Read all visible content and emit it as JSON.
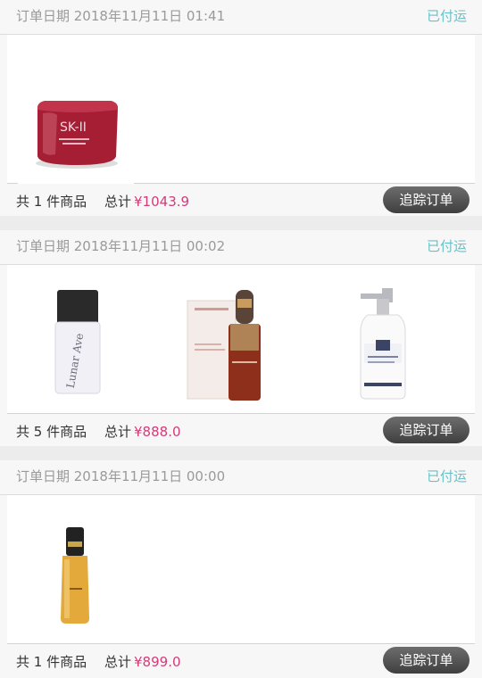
{
  "orders": [
    {
      "date_label": "订单日期 2018年11月11日 01:41",
      "status": "已付运",
      "products": [
        {
          "icon": "sk2-cream-jar-icon"
        }
      ],
      "item_count": "共 1 件商品",
      "total_label": "总计",
      "total_amount": "¥1043.9",
      "track_button": "追踪订单"
    },
    {
      "date_label": "订单日期 2018年11月11日 00:02",
      "status": "已付运",
      "products": [
        {
          "icon": "primer-bottle-icon"
        },
        {
          "icon": "serum-dropper-box-icon"
        },
        {
          "icon": "pump-lotion-bottle-icon"
        }
      ],
      "item_count": "共 5 件商品",
      "total_label": "总计",
      "total_amount": "¥888.0",
      "track_button": "追踪订单"
    },
    {
      "date_label": "订单日期 2018年11月11日 00:00",
      "status": "已付运",
      "products": [
        {
          "icon": "gold-serum-bottle-icon"
        }
      ],
      "item_count": "共 1 件商品",
      "total_label": "总计",
      "total_amount": "¥899.0",
      "track_button": "追踪订单"
    }
  ],
  "colors": {
    "status": "#68c2c8",
    "amount": "#d33b7a",
    "button": "#4f4f4f"
  }
}
